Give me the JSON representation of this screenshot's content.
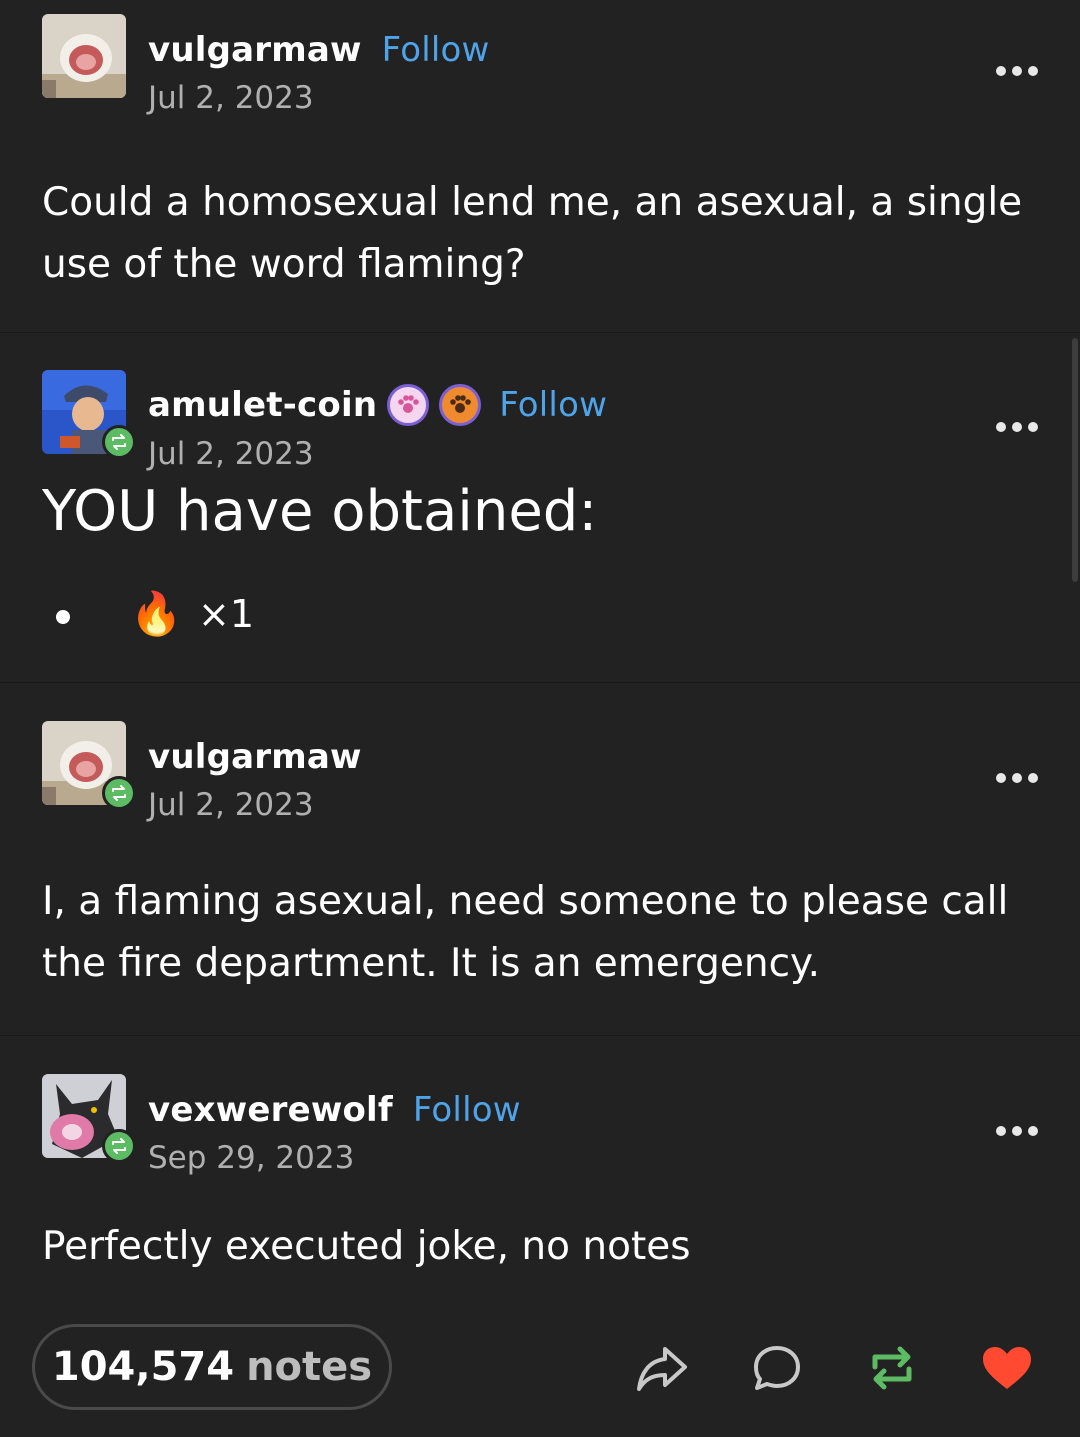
{
  "posts": [
    {
      "username": "vulgarmaw",
      "follow_label": "Follow",
      "date": "Jul 2, 2023",
      "text": "Could a homosexual lend me, an asexual, a single use of the word flaming?",
      "avatar_icon": "toilet-avatar"
    },
    {
      "username": "amulet-coin",
      "follow_label": "Follow",
      "date": "Jul 2, 2023",
      "heading": "YOU have obtained:",
      "list_item": {
        "emoji": "🔥",
        "quantity": "×1"
      },
      "avatar_icon": "character-avatar",
      "badges": [
        "paw-badge-pink",
        "paw-badge-orange"
      ]
    },
    {
      "username": "vulgarmaw",
      "date": "Jul 2, 2023",
      "text": "I, a flaming asexual, need someone to please call the fire department. It is an emergency.",
      "avatar_icon": "toilet-avatar"
    },
    {
      "username": "vexwerewolf",
      "follow_label": "Follow",
      "date": "Sep 29, 2023",
      "text": "Perfectly executed joke, no notes",
      "avatar_icon": "werewolf-avatar"
    }
  ],
  "footer": {
    "notes_count": "104,574",
    "notes_label": "notes",
    "actions": [
      "share-icon",
      "reply-icon",
      "reblog-icon",
      "like-icon"
    ]
  },
  "colors": {
    "background": "#222222",
    "follow": "#4fa3e8",
    "reblog": "#5dbb63",
    "like": "#ff4930"
  }
}
